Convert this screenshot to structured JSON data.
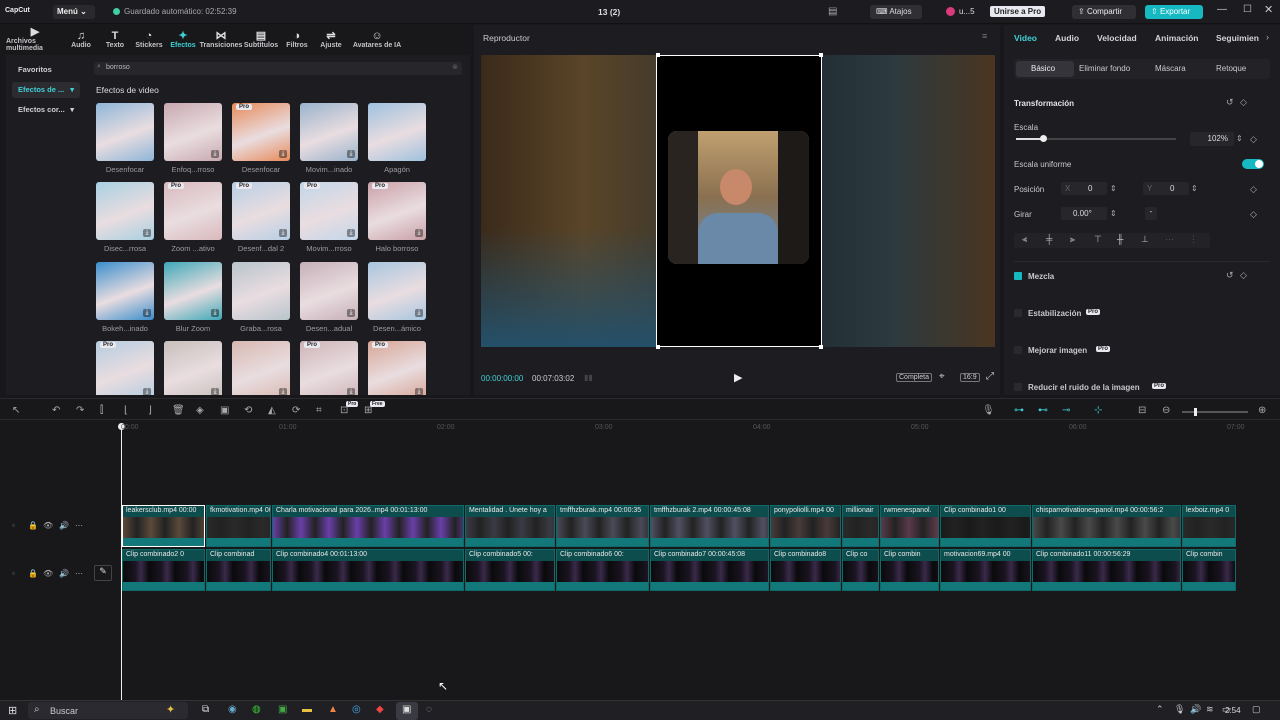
{
  "app": {
    "logo": "CapCut",
    "menu_label": "Menú",
    "autosave": "Guardado automático: 02:52:39",
    "project_title": "13 (2)",
    "shortcuts": "Atajos",
    "user": "u...5",
    "join_pro": "Unirse a Pro",
    "share": "Compartir",
    "export": "Exportar"
  },
  "toolbar": [
    {
      "label": "Archivos multimedia",
      "icon": "media-icon"
    },
    {
      "label": "Audio",
      "icon": "audio-icon"
    },
    {
      "label": "Texto",
      "icon": "text-icon"
    },
    {
      "label": "Stickers",
      "icon": "sticker-icon"
    },
    {
      "label": "Efectos",
      "icon": "effects-icon"
    },
    {
      "label": "Transiciones",
      "icon": "transition-icon"
    },
    {
      "label": "Subtítulos",
      "icon": "subtitles-icon"
    },
    {
      "label": "Filtros",
      "icon": "filter-icon"
    },
    {
      "label": "Ajuste",
      "icon": "adjust-icon"
    },
    {
      "label": "Avatares de IA",
      "icon": "avatar-icon"
    }
  ],
  "left_nav": [
    "Favoritos",
    "Efectos de ...",
    "Efectos cor..."
  ],
  "search": {
    "value": "borroso"
  },
  "effects_heading": "Efectos de video",
  "effects": [
    {
      "label": "Desenfocar",
      "pro": false,
      "dl": false,
      "color": "#8fb6d8"
    },
    {
      "label": "Enfoq...rroso",
      "pro": false,
      "dl": true,
      "color": "#c8a9b0"
    },
    {
      "label": "Desenfocar",
      "pro": true,
      "dl": true,
      "color": "#e88a5a"
    },
    {
      "label": "Movim...inado",
      "pro": false,
      "dl": true,
      "color": "#9ab3cc"
    },
    {
      "label": "Apagón",
      "pro": false,
      "dl": false,
      "color": "#9fc1de"
    },
    {
      "label": "Disec...rrosa",
      "pro": false,
      "dl": true,
      "color": "#a9d0e2"
    },
    {
      "label": "Zoom ...ativo",
      "pro": true,
      "dl": false,
      "color": "#d9b9bd"
    },
    {
      "label": "Desenf...dal 2",
      "pro": true,
      "dl": true,
      "color": "#b8cfe5"
    },
    {
      "label": "Movim...rroso",
      "pro": true,
      "dl": true,
      "color": "#c3d6ea"
    },
    {
      "label": "Halo borroso",
      "pro": true,
      "dl": true,
      "color": "#c9a0a8"
    },
    {
      "label": "Bokeh...inado",
      "pro": false,
      "dl": true,
      "color": "#3b8ecc"
    },
    {
      "label": "Blur Zoom",
      "pro": false,
      "dl": true,
      "color": "#3ea8b8"
    },
    {
      "label": "Graba...rosa",
      "pro": false,
      "dl": false,
      "color": "#b8c4cc"
    },
    {
      "label": "Desen...adual",
      "pro": false,
      "dl": true,
      "color": "#c6b0b8"
    },
    {
      "label": "Desen...ámico",
      "pro": false,
      "dl": true,
      "color": "#a8c6e0"
    },
    {
      "label": "",
      "pro": true,
      "dl": true,
      "color": "#b6cce0"
    },
    {
      "label": "",
      "pro": false,
      "dl": true,
      "color": "#c8c0bc"
    },
    {
      "label": "",
      "pro": false,
      "dl": true,
      "color": "#d8b8b0"
    },
    {
      "label": "",
      "pro": true,
      "dl": true,
      "color": "#cdb4b8"
    },
    {
      "label": "",
      "pro": true,
      "dl": true,
      "color": "#d7a596"
    }
  ],
  "player": {
    "title": "Reproductor",
    "current_time": "00:00:00:00",
    "total_time": "00:07:03:02",
    "fit_label": "Completa",
    "ratio": "16:9"
  },
  "props": {
    "tabs": [
      "Video",
      "Audio",
      "Velocidad",
      "Animación",
      "Seguimien"
    ],
    "subtabs": [
      "Básico",
      "Eliminar fondo",
      "Máscara",
      "Retoque"
    ],
    "transform_title": "Transformación",
    "scale_label": "Escala",
    "scale_value": "102%",
    "scale_fraction": 0.17,
    "uniform_label": "Escala uniforme",
    "position_label": "Posición",
    "pos_x_label": "X",
    "pos_x": "0",
    "pos_y_label": "Y",
    "pos_y": "0",
    "rotate_label": "Girar",
    "rotate_value": "0.00°",
    "rotate_dash": "-",
    "blend_label": "Mezcla",
    "stabilize_label": "Estabilización",
    "enhance_label": "Mejorar imagen",
    "denoise_label": "Reducir el ruido de la imagen",
    "pro_badge": "Pro",
    "free_badge": "Free"
  },
  "timeline": {
    "ticks": [
      "00:00",
      "01:00",
      "02:00",
      "03:00",
      "04:00",
      "05:00",
      "06:00",
      "07:00"
    ],
    "track1": [
      {
        "label": "leakersclub.mp4  00:00",
        "color": "#5a4a3a"
      },
      {
        "label": "fkmotivation.mp4  00:00",
        "color": "#2a2a2a"
      },
      {
        "label": "Charla motivacional para 2026..mp4  00:01:13:00",
        "color": "#6a3fa8"
      },
      {
        "label": "Mentalidad . Únete hoy a",
        "color": "#3a3a44"
      },
      {
        "label": "tmffhzburak.mp4  00:00:35",
        "color": "#4a4a58"
      },
      {
        "label": "tmffhzburak 2.mp4  00:00:45:08",
        "color": "#505062"
      },
      {
        "label": "ponypoliolli.mp4  00",
        "color": "#4a3a3a"
      },
      {
        "label": "millionair",
        "color": "#2a2a2a"
      },
      {
        "label": "rwmenespanol.",
        "color": "#5a3a4a"
      },
      {
        "label": "Clip combinado1  00",
        "color": "#1a1a1a"
      },
      {
        "label": "chispamotivationespanol.mp4  00:00:56:2",
        "color": "#4a4a4a"
      },
      {
        "label": "lexboiz.mp4  0",
        "color": "#2a2a2a"
      }
    ],
    "track2": [
      {
        "label": "Clip combinado2  0"
      },
      {
        "label": "Clip combinad"
      },
      {
        "label": "Clip combinado4  00:01:13:00"
      },
      {
        "label": "Clip combinado5  00:"
      },
      {
        "label": "Clip combinado6  00:"
      },
      {
        "label": "Clip combinado7  00:00:45:08"
      },
      {
        "label": "Clip combinado8"
      },
      {
        "label": "Clip co"
      },
      {
        "label": "Clip combin"
      },
      {
        "label": "motivacion69.mp4  00"
      },
      {
        "label": "Clip combinado11  00:00:56:29"
      },
      {
        "label": "Clip combin"
      }
    ]
  },
  "taskbar": {
    "search": "Buscar",
    "clock": "2:54"
  }
}
